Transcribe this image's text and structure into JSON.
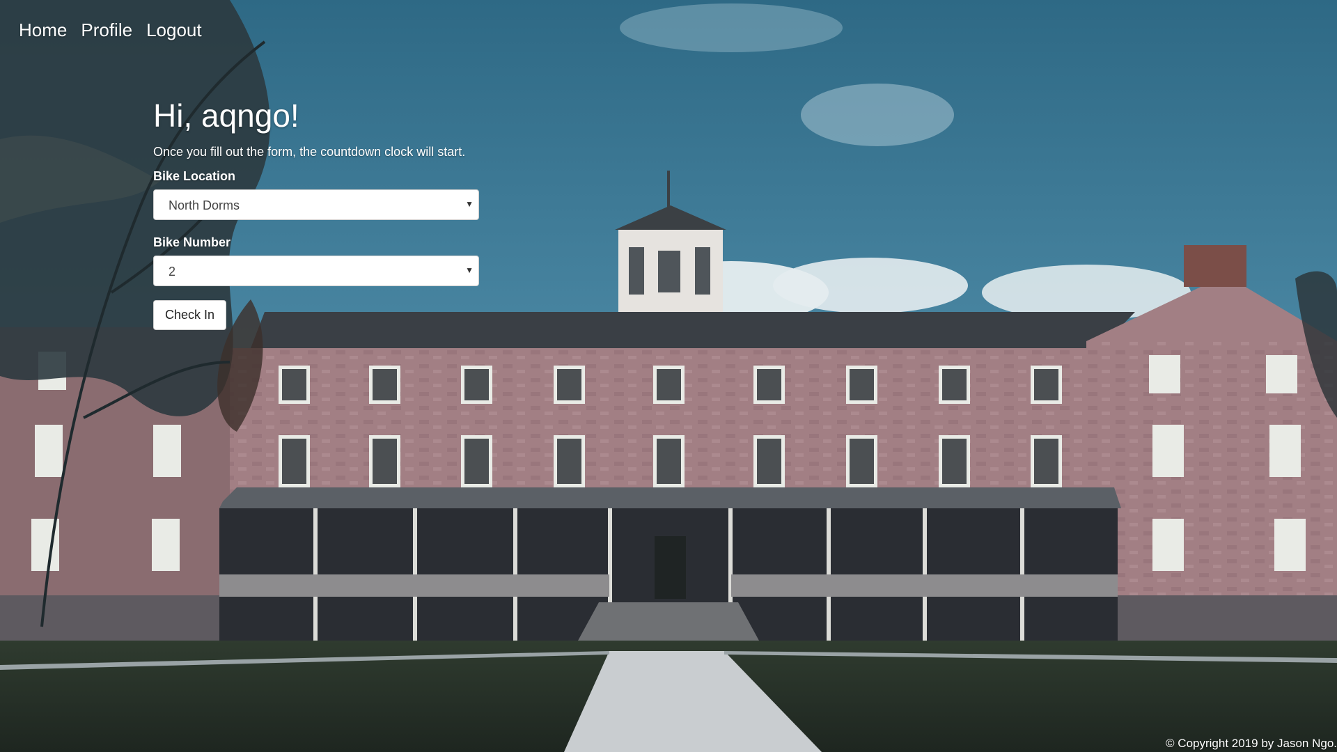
{
  "nav": {
    "items": [
      {
        "label": "Home"
      },
      {
        "label": "Profile"
      },
      {
        "label": "Logout"
      }
    ]
  },
  "main": {
    "greeting": "Hi, aqngo!",
    "instructions": "Once you fill out the form, the countdown clock will start.",
    "bike_location": {
      "label": "Bike Location",
      "selected": "North Dorms"
    },
    "bike_number": {
      "label": "Bike Number",
      "selected": "2"
    },
    "submit_label": "Check In"
  },
  "footer": {
    "copyright": "© Copyright 2019 by Jason Ngo."
  },
  "colors": {
    "sky": "#3f7896",
    "brick": "#a07c80",
    "roof": "#3c4246",
    "lawn": "#2a3a2e",
    "text": "#ffffff"
  },
  "icons": {
    "select_arrow": "caret-down-icon"
  }
}
